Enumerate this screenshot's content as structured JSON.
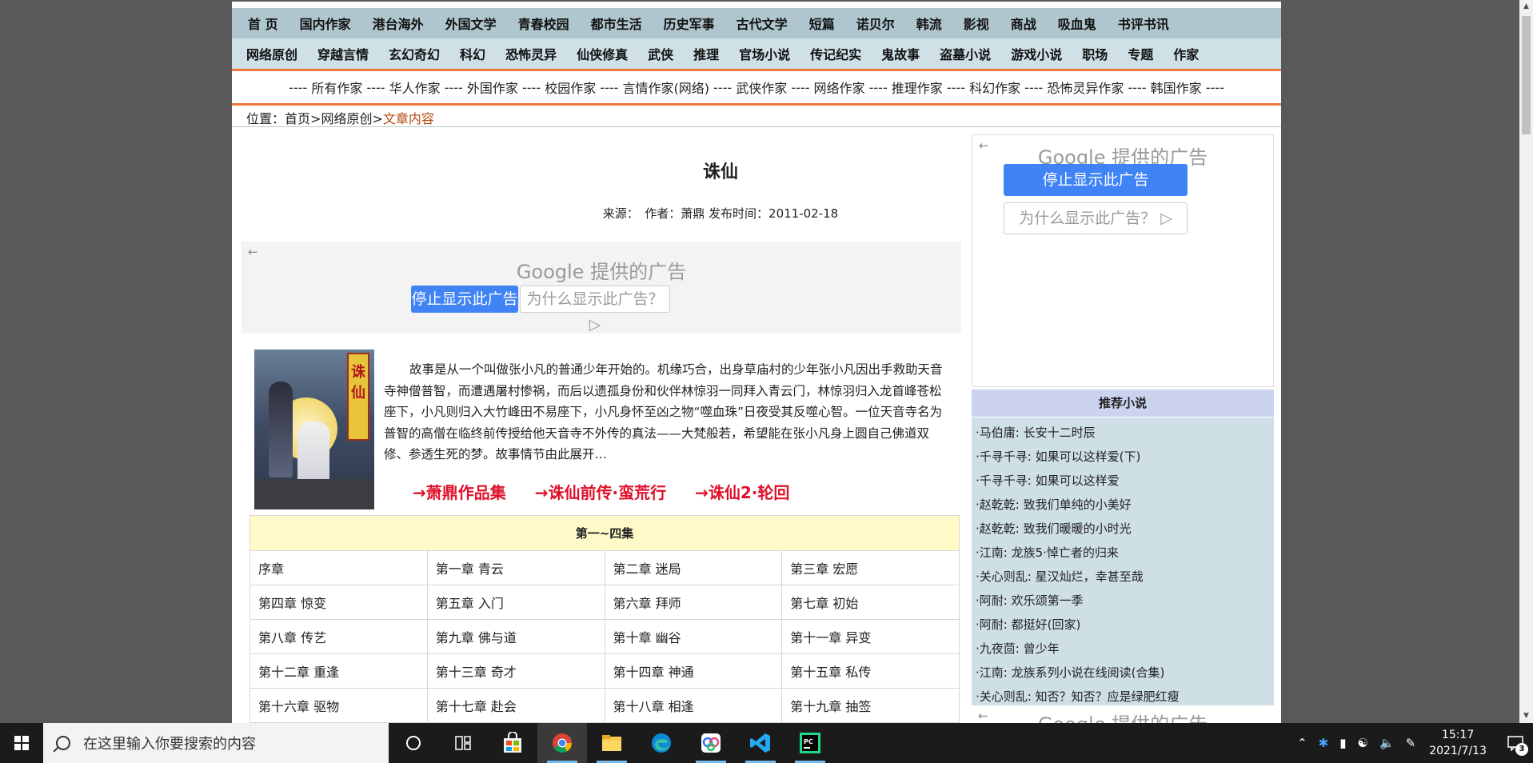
{
  "nav_primary": [
    "首 页",
    "国内作家",
    "港台海外",
    "外国文学",
    "青春校园",
    "都市生活",
    "历史军事",
    "古代文学",
    "短篇",
    "诺贝尔",
    "韩流",
    "影视",
    "商战",
    "吸血鬼",
    "书评书讯"
  ],
  "nav_secondary": [
    "网络原创",
    "穿越言情",
    "玄幻奇幻",
    "科幻",
    "恐怖灵异",
    "仙侠修真",
    "武侠",
    "推理",
    "官场小说",
    "传记纪实",
    "鬼故事",
    "盗墓小说",
    "游戏小说",
    "职场",
    "专题",
    "作家"
  ],
  "writer_categories": [
    "所有作家",
    "华人作家",
    "外国作家",
    "校园作家",
    "言情作家(网络)",
    "武侠作家",
    "网络作家",
    "推理作家",
    "科幻作家",
    "恐怖灵异作家",
    "韩国作家"
  ],
  "breadcrumb": {
    "label": "位置：",
    "home": "首页",
    "section": "网络原创",
    "current": "文章内容"
  },
  "article": {
    "title": "诛仙",
    "meta": "来源：　作者：萧鼎 发布时间：2011-02-18",
    "synopsis": "故事是从一个叫做张小凡的普通少年开始的。机缘巧合，出身草庙村的少年张小凡因出手救助天音寺神僧普智，而遭遇屠村惨祸，而后以遗孤身份和伙伴林惊羽一同拜入青云门，林惊羽归入龙首峰苍松座下，小凡则归入大竹峰田不易座下，小凡身怀至凶之物“噬血珠”日夜受其反噬心智。一位天音寺名为普智的高僧在临终前传授给他天音寺不外传的真法——大梵般若，希望能在张小凡身上圆自己佛道双修、参透生死的梦。故事情节由此展开…",
    "cover_title": "诛仙",
    "links": [
      "→萧鼎作品集",
      "→诛仙前传·蛮荒行",
      "→诛仙2·轮回"
    ]
  },
  "ads": {
    "google_label": "Google 提供的广告",
    "stop_button": "停止显示此广告",
    "why_button": "为什么显示此广告？",
    "back_icon": "←"
  },
  "chapters": {
    "volume": "第一~四集",
    "rows": [
      [
        "序章",
        "第一章 青云",
        "第二章 迷局",
        "第三章 宏愿"
      ],
      [
        "第四章 惊变",
        "第五章 入门",
        "第六章 拜师",
        "第七章 初始"
      ],
      [
        "第八章 传艺",
        "第九章 佛与道",
        "第十章 幽谷",
        "第十一章 异变"
      ],
      [
        "第十二章 重逢",
        "第十三章 奇才",
        "第十四章 神通",
        "第十五章 私传"
      ],
      [
        "第十六章 驱物",
        "第十七章 赴会",
        "第十八章 相逢",
        "第十九章 抽签"
      ]
    ]
  },
  "sidebar": {
    "recommend_title": "推荐小说",
    "items": [
      "·马伯庸: 长安十二时辰",
      "·千寻千寻: 如果可以这样爱(下)",
      "·千寻千寻: 如果可以这样爱",
      "·赵乾乾: 致我们单纯的小美好",
      "·赵乾乾: 致我们暖暖的小时光",
      "·江南: 龙族5·悼亡者的归来",
      "·关心则乱: 星汉灿烂，幸甚至哉",
      "·阿耐: 欢乐颂第一季",
      "·阿耐: 都挺好(回家)",
      "·九夜茴: 曾少年",
      "·江南: 龙族系列小说在线阅读(合集)",
      "·关心则乱: 知否？知否？应是绿肥红瘦"
    ]
  },
  "taskbar": {
    "search_placeholder": "在这里输入你要搜索的内容",
    "time": "15:17",
    "date": "2021/7/13",
    "notification_count": "3"
  },
  "colors": {
    "accent_orange": "#f07838",
    "ad_blue": "#3f83f5",
    "link_red": "#e0102a"
  }
}
